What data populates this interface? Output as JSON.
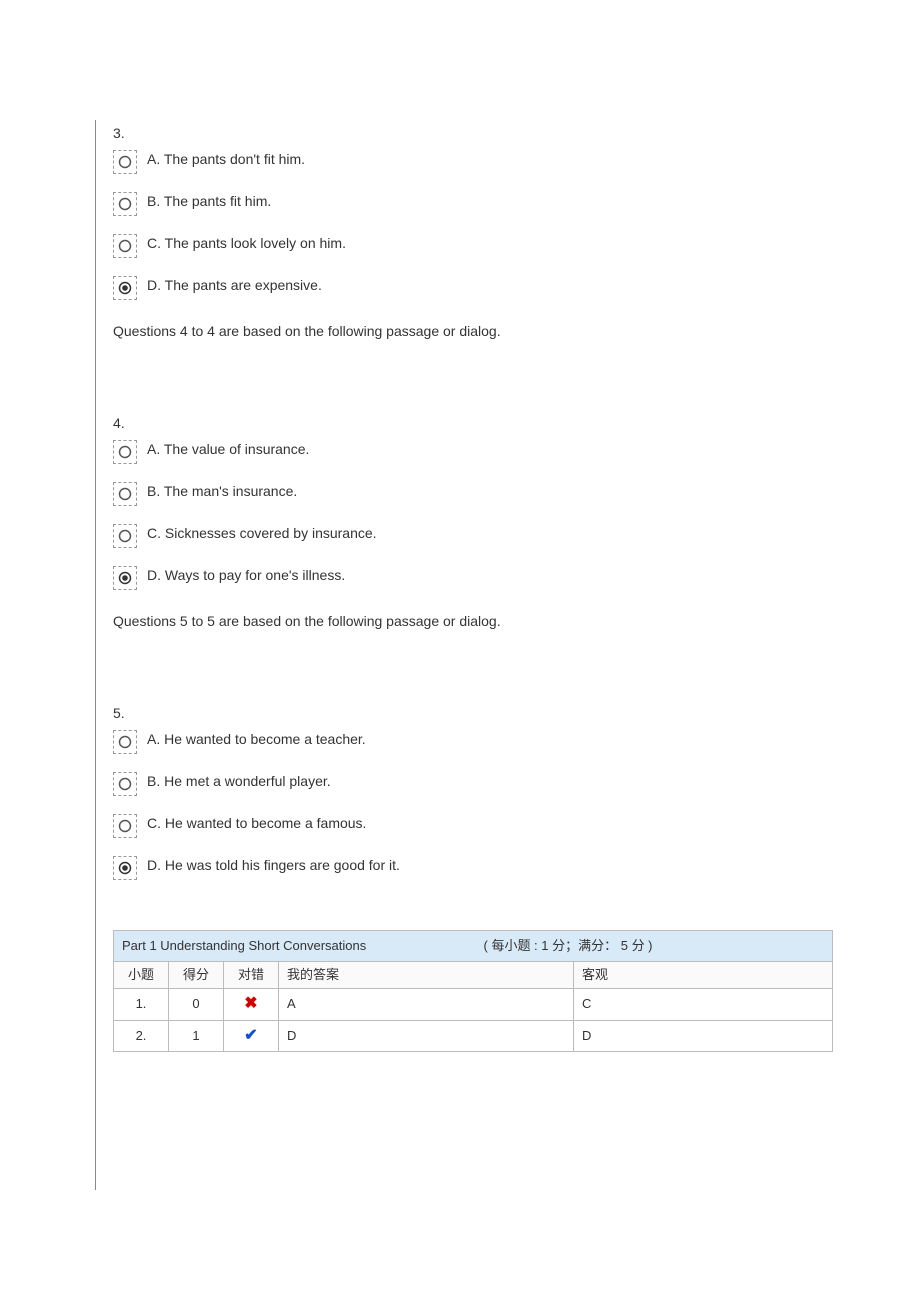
{
  "q3": {
    "number": "3.",
    "options": [
      {
        "text": "A. The pants don't fit him.",
        "selected": false
      },
      {
        "text": "B. The pants fit him.",
        "selected": false
      },
      {
        "text": "C. The pants look lovely on him.",
        "selected": false
      },
      {
        "text": "D. The pants are expensive.",
        "selected": true
      }
    ]
  },
  "note4": "Questions 4 to 4 are based on the following passage or dialog.",
  "q4": {
    "number": "4.",
    "options": [
      {
        "text": "A. The value of insurance.",
        "selected": false
      },
      {
        "text": "B. The man's insurance.",
        "selected": false
      },
      {
        "text": "C. Sicknesses covered by insurance.",
        "selected": false
      },
      {
        "text": "D. Ways to pay for one's illness.",
        "selected": true
      }
    ]
  },
  "note5": "Questions 5 to 5 are based on the following passage or dialog.",
  "q5": {
    "number": "5.",
    "options": [
      {
        "text": "A. He wanted to become a teacher.",
        "selected": false
      },
      {
        "text": "B. He met a wonderful player.",
        "selected": false
      },
      {
        "text": "C. He wanted to become a famous.",
        "selected": false
      },
      {
        "text": "D. He was told his fingers are good for it.",
        "selected": true
      }
    ]
  },
  "results": {
    "title_left": "Part 1 Understanding Short Conversations",
    "title_right": "( 每小题 : 1  分；满分：  5  分 )",
    "headers": {
      "q": "小题",
      "score": "得分",
      "ok": "对错",
      "my": "我的答案",
      "obj": "客观"
    },
    "rows": [
      {
        "q": "1.",
        "score": "0",
        "correct": false,
        "my": "A",
        "obj": "C"
      },
      {
        "q": "2.",
        "score": "1",
        "correct": true,
        "my": "D",
        "obj": "D"
      }
    ]
  },
  "marks": {
    "wrong": "✖",
    "right": "✔"
  }
}
